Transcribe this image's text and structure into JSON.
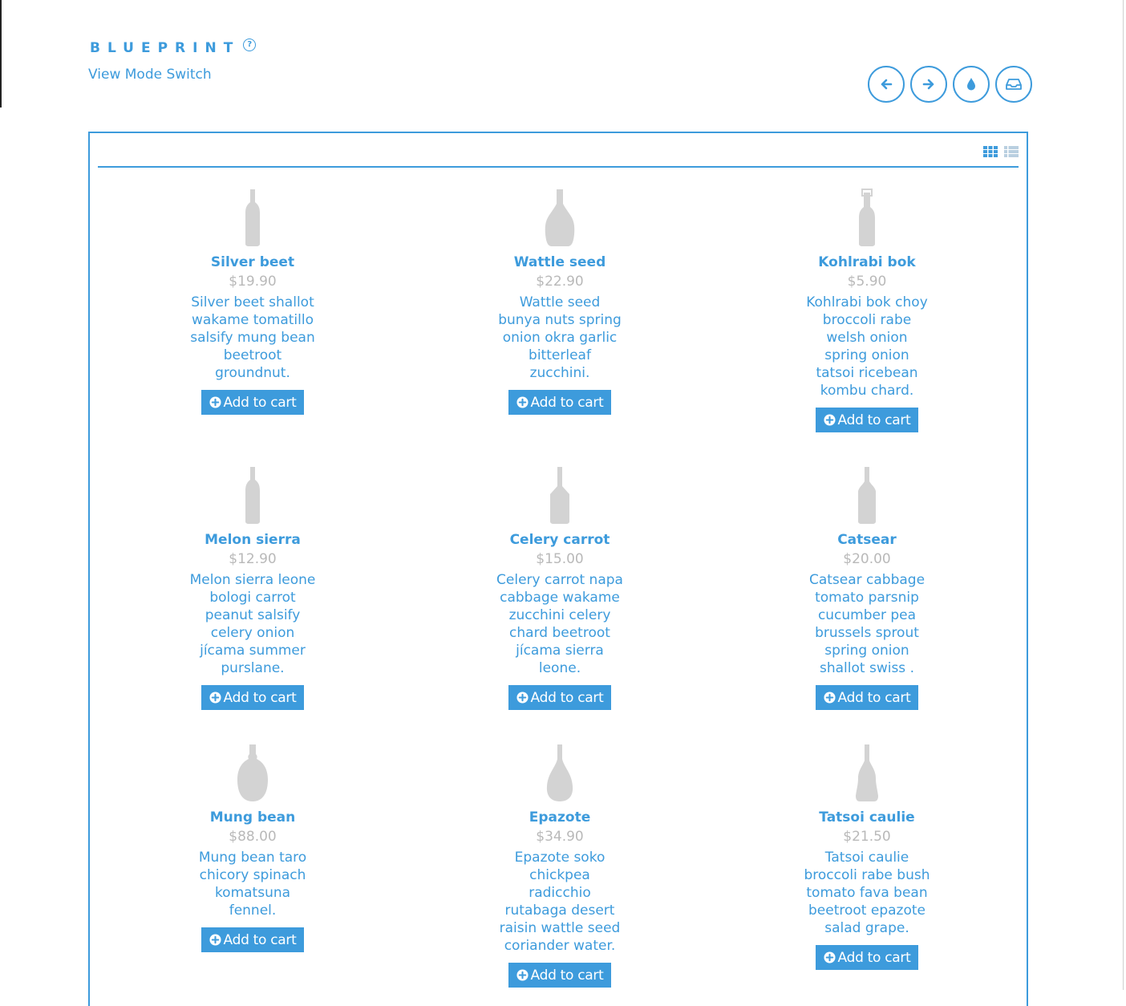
{
  "header": {
    "brand": "BLUEPRINT",
    "help_glyph": "?",
    "view_mode_link": "View Mode Switch",
    "round_buttons": [
      {
        "icon": "arrow-left-icon"
      },
      {
        "icon": "arrow-right-icon"
      },
      {
        "icon": "drop-icon"
      },
      {
        "icon": "inbox-icon"
      }
    ]
  },
  "toolbar": {
    "view_toggle": [
      "grid-view-icon",
      "list-view-icon"
    ],
    "active_view": "grid"
  },
  "colors": {
    "accent": "#3d9bdc",
    "price": "#b9b9b9",
    "bottle": "#d3d3d3"
  },
  "products": [
    {
      "name": "Silver beet",
      "price": "$19.90",
      "description": "Silver beet shallot wakame tomatillo salsify mung bean beetroot groundnut.",
      "button": "Add to cart",
      "bottle": "slim"
    },
    {
      "name": "Wattle seed",
      "price": "$22.90",
      "description": "Wattle seed bunya nuts spring onion okra garlic bitterleaf zucchini.",
      "button": "Add to cart",
      "bottle": "wide"
    },
    {
      "name": "Kohlrabi bok",
      "price": "$5.90",
      "description": "Kohlrabi bok choy broccoli rabe welsh onion spring onion tatsoi ricebean kombu chard.",
      "button": "Add to cart",
      "bottle": "swing"
    },
    {
      "name": "Melon sierra",
      "price": "$12.90",
      "description": "Melon sierra leone bologi carrot peanut salsify celery onion jícama summer purslane.",
      "button": "Add to cart",
      "bottle": "slim"
    },
    {
      "name": "Celery carrot",
      "price": "$15.00",
      "description": "Celery carrot napa cabbage wakame zucchini celery chard beetroot jícama sierra leone.",
      "button": "Add to cart",
      "bottle": "square"
    },
    {
      "name": "Catsear",
      "price": "$20.00",
      "description": "Catsear cabbage tomato parsnip cucumber pea brussels sprout spring onion shallot swiss .",
      "button": "Add to cart",
      "bottle": "shoulder"
    },
    {
      "name": "Mung bean",
      "price": "$88.00",
      "description": "Mung bean taro chicory spinach komatsuna fennel.",
      "button": "Add to cart",
      "bottle": "round"
    },
    {
      "name": "Epazote",
      "price": "$34.90",
      "description": "Epazote soko chickpea radicchio rutabaga desert raisin wattle seed coriander water.",
      "button": "Add to cart",
      "bottle": "teardrop"
    },
    {
      "name": "Tatsoi caulie",
      "price": "$21.50",
      "description": "Tatsoi caulie broccoli rabe bush tomato fava bean beetroot epazote salad grape.",
      "button": "Add to cart",
      "bottle": "flared"
    }
  ]
}
